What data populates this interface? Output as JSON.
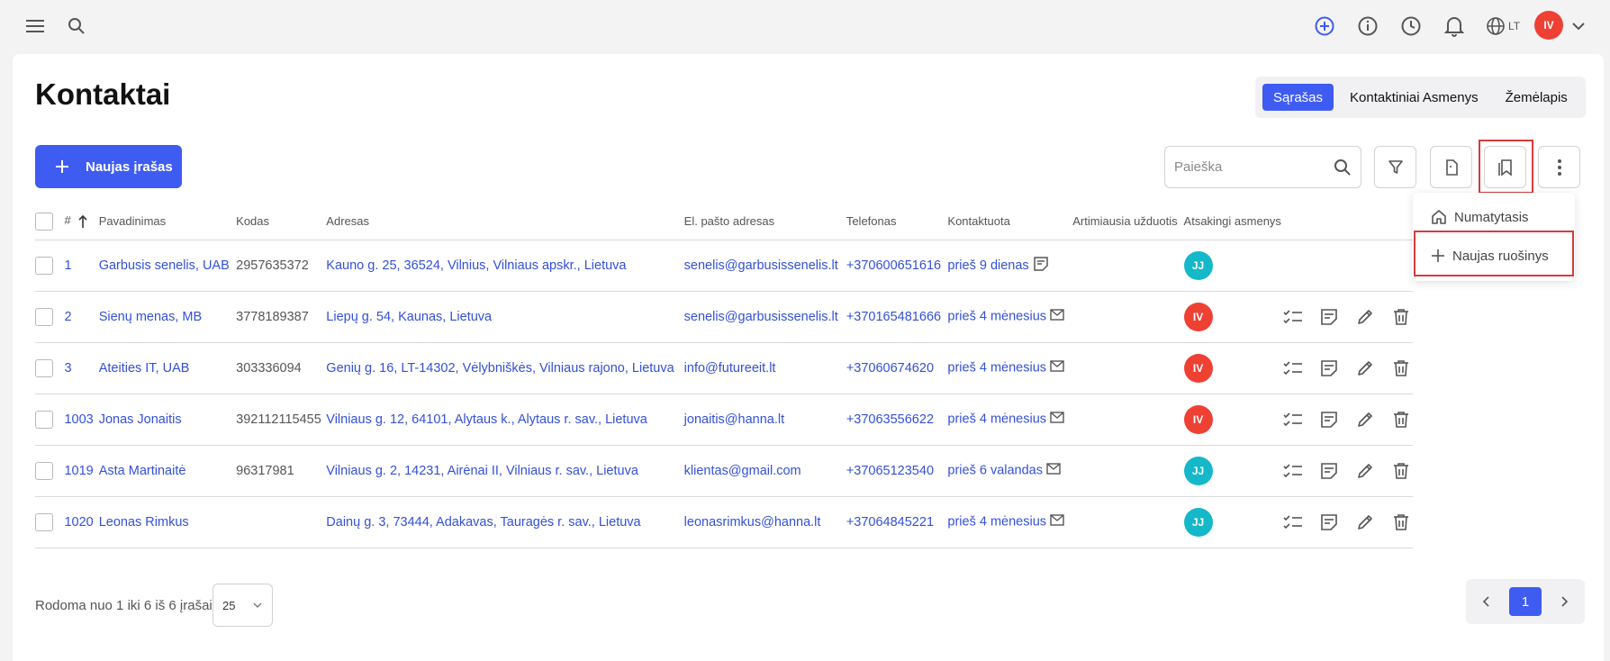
{
  "header": {
    "language": "LT",
    "user_initials": "IV",
    "icons": [
      "menu-icon",
      "search-icon",
      "add-circle-icon",
      "info-icon",
      "clock-icon",
      "bell-icon",
      "globe-icon",
      "chevron-down-icon"
    ]
  },
  "page": {
    "title": "Kontaktai",
    "view_tabs": [
      {
        "label": "Sąrašas",
        "active": true
      },
      {
        "label": "Kontaktiniai Asmenys",
        "active": false
      },
      {
        "label": "Žemėlapis",
        "active": false
      }
    ],
    "new_button_label": "Naujas įrašas",
    "search_placeholder": "Paieška"
  },
  "dropdown": {
    "items": [
      {
        "label": "Numatytasis",
        "icon": "home-icon"
      },
      {
        "label": "Naujas ruošinys",
        "icon": "plus-icon"
      }
    ]
  },
  "table": {
    "columns": [
      "#",
      "Pavadinimas",
      "Kodas",
      "Adresas",
      "El. pašto adresas",
      "Telefonas",
      "Kontaktuota",
      "Artimiausia užduotis",
      "Atsakingi asmenys"
    ],
    "rows": [
      {
        "id": "1",
        "name": "Garbusis senelis, UAB",
        "code": "2957635372",
        "address": "Kauno g. 25, 36524, Vilnius, Vilniaus apskr., Lietuva",
        "email": "senelis@garbusissenelis.lt",
        "phone": "+370600651616",
        "contacted": "prieš 9 dienas",
        "contact_icon": "note-icon",
        "avatar": "JJ",
        "avatar_color": "#14b8c9"
      },
      {
        "id": "2",
        "name": "Sienų menas, MB",
        "code": "3778189387",
        "address": "Liepų g. 54, Kaunas, Lietuva",
        "email": "senelis@garbusissenelis.lt",
        "phone": "+370165481666",
        "contacted": "prieš 4 mėnesius",
        "contact_icon": "mail-icon",
        "avatar": "IV",
        "avatar_color": "#ef4034"
      },
      {
        "id": "3",
        "name": "Ateities IT, UAB",
        "code": "303336094",
        "address": "Genių g. 16, LT-14302, Vėlybniškės, Vilniaus rajono, Lietuva",
        "email": "info@futureeit.lt",
        "phone": "+37060674620",
        "contacted": "prieš 4 mėnesius",
        "contact_icon": "mail-icon",
        "avatar": "IV",
        "avatar_color": "#ef4034"
      },
      {
        "id": "1003",
        "name": "Jonas Jonaitis",
        "code": "392112115455",
        "address": "Vilniaus g. 12, 64101, Alytaus k., Alytaus r. sav., Lietuva",
        "email": "jonaitis@hanna.lt",
        "phone": "+37063556622",
        "contacted": "prieš 4 mėnesius",
        "contact_icon": "mail-icon",
        "avatar": "IV",
        "avatar_color": "#ef4034"
      },
      {
        "id": "1019",
        "name": "Asta Martinaitė",
        "code": "96317981",
        "address": "Vilniaus g. 2, 14231, Airėnai II, Vilniaus r. sav., Lietuva",
        "email": "klientas@gmail.com",
        "phone": "+37065123540",
        "contacted": "prieš 6 valandas",
        "contact_icon": "mail-icon",
        "avatar": "JJ",
        "avatar_color": "#14b8c9"
      },
      {
        "id": "1020",
        "name": "Leonas Rimkus",
        "code": "",
        "address": "Dainų g. 3, 73444, Adakavas, Tauragės r. sav., Lietuva",
        "email": "leonasrimkus@hanna.lt",
        "phone": "+37064845221",
        "contacted": "prieš 4 mėnesius",
        "contact_icon": "mail-icon",
        "avatar": "JJ",
        "avatar_color": "#14b8c9"
      }
    ]
  },
  "footer": {
    "summary": "Rodoma nuo 1 iki 6 iš 6 įrašai",
    "per_page": "25",
    "current_page": "1"
  },
  "colors": {
    "accent": "#3f5cf2",
    "link": "#3350d9",
    "highlight": "#d83a3a"
  }
}
